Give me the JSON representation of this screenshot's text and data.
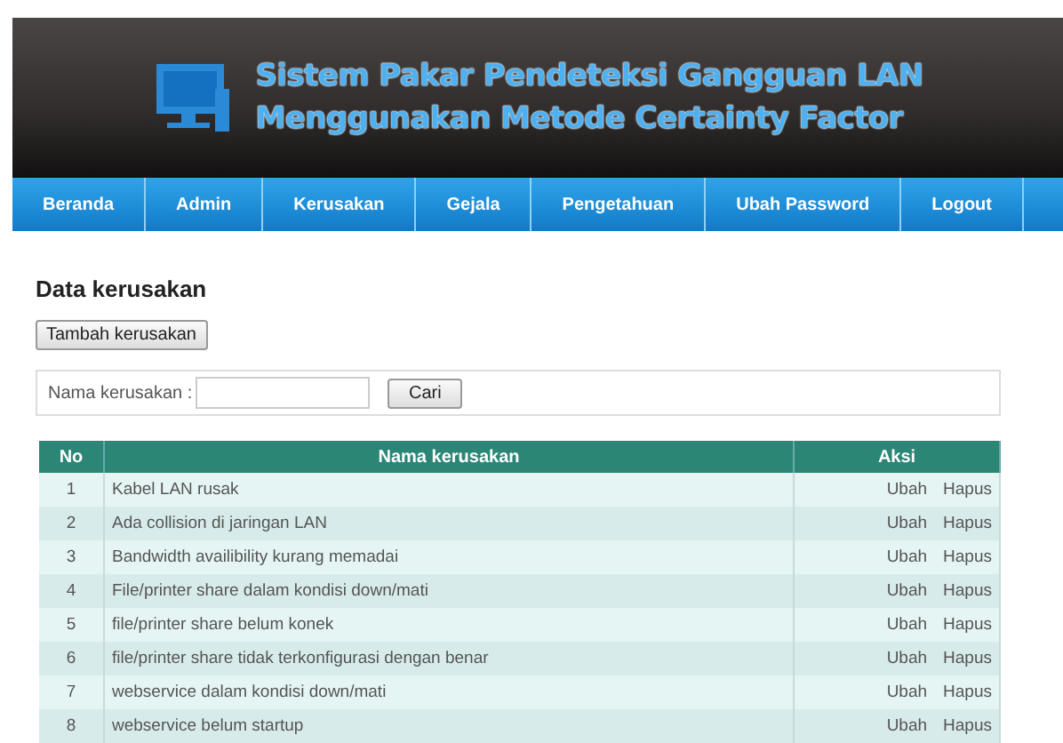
{
  "header": {
    "title_lines": [
      "Sistem Pakar Pendeteksi Gangguan LAN",
      "Menggunakan Metode Certainty Factor"
    ]
  },
  "nav": [
    {
      "label": "Beranda"
    },
    {
      "label": "Admin"
    },
    {
      "label": "Kerusakan"
    },
    {
      "label": "Gejala"
    },
    {
      "label": "Pengetahuan"
    },
    {
      "label": "Ubah Password"
    },
    {
      "label": "Logout"
    }
  ],
  "heading": "Data kerusakan",
  "add_button": "Tambah kerusakan",
  "search": {
    "label": "Nama kerusakan :",
    "button": "Cari"
  },
  "table": {
    "columns": [
      "No",
      "Nama kerusakan",
      "Aksi"
    ],
    "rows": [
      {
        "no": "1",
        "name": "Kabel LAN rusak",
        "actions": [
          "Ubah",
          "Hapus"
        ]
      },
      {
        "no": "2",
        "name": "Ada collision di jaringan LAN",
        "actions": [
          "Ubah",
          "Hapus"
        ]
      },
      {
        "no": "3",
        "name": "Bandwidth availibility kurang memadai",
        "actions": [
          "Ubah",
          "Hapus"
        ]
      },
      {
        "no": "4",
        "name": "File/printer share dalam kondisi down/mati",
        "actions": [
          "Ubah",
          "Hapus"
        ]
      },
      {
        "no": "5",
        "name": "file/printer share belum konek",
        "actions": [
          "Ubah",
          "Hapus"
        ]
      },
      {
        "no": "6",
        "name": "file/printer share tidak terkonfigurasi dengan benar",
        "actions": [
          "Ubah",
          "Hapus"
        ]
      },
      {
        "no": "7",
        "name": "webservice dalam kondisi down/mati",
        "actions": [
          "Ubah",
          "Hapus"
        ]
      },
      {
        "no": "8",
        "name": "webservice belum startup",
        "actions": [
          "Ubah",
          "Hapus"
        ]
      }
    ]
  }
}
